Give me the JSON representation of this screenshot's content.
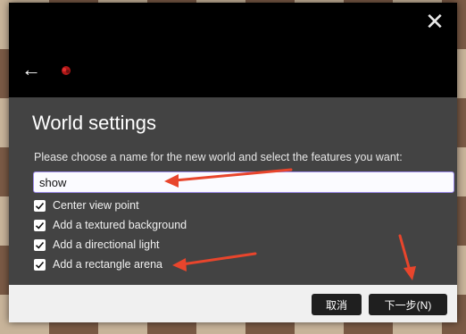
{
  "dialog": {
    "title": "World settings",
    "prompt": "Please choose a name for the new world and select the features you want:",
    "name_input_value": "show",
    "close_glyph": "✕",
    "back_glyph": "←"
  },
  "options": [
    {
      "label": "Center view point",
      "checked": true
    },
    {
      "label": "Add a textured background",
      "checked": true
    },
    {
      "label": "Add a directional light",
      "checked": true
    },
    {
      "label": "Add a rectangle arena",
      "checked": true
    }
  ],
  "footer": {
    "cancel_label": "取消",
    "next_label": "下一步(N)"
  },
  "colors": {
    "dialog_bg": "#434343",
    "header_bg": "#000000",
    "input_border": "#9a88e8",
    "annotation_arrow": "#e8452c"
  }
}
